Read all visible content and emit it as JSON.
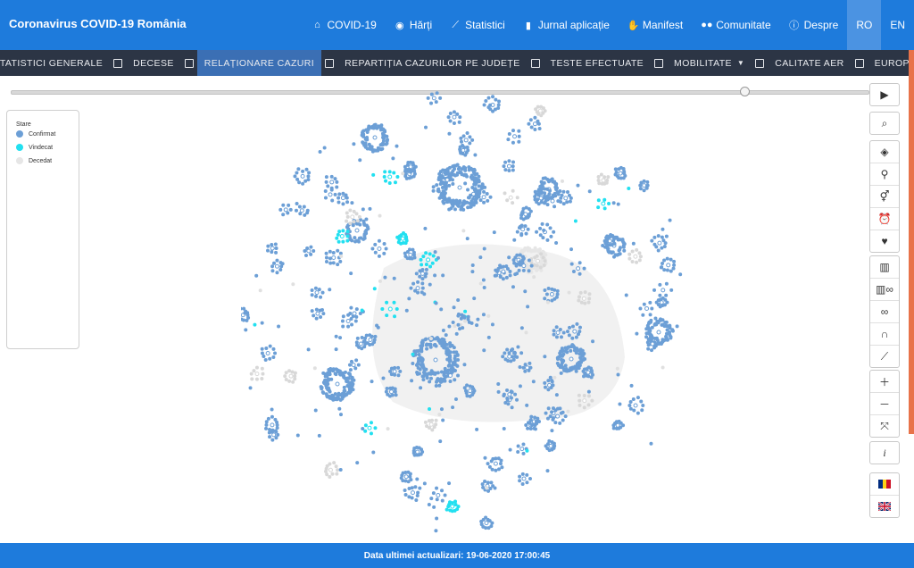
{
  "app": {
    "title": "Coronavirus COVID-19 România"
  },
  "nav": {
    "items": [
      {
        "label": "COVID-19",
        "icon": "home-icon"
      },
      {
        "label": "Hărți",
        "icon": "compass-icon"
      },
      {
        "label": "Statistici",
        "icon": "chart-icon"
      },
      {
        "label": "Jurnal aplicație",
        "icon": "file-icon"
      },
      {
        "label": "Manifest",
        "icon": "hand-icon"
      },
      {
        "label": "Comunitate",
        "icon": "users-icon"
      },
      {
        "label": "Despre",
        "icon": "info-icon"
      }
    ],
    "lang_ro": "RO",
    "lang_en": "EN"
  },
  "subnav": {
    "items": [
      "STATISTICI GENERALE",
      "DECESE",
      "RELAȚIONARE CAZURI",
      "REPARTIȚIA CAZURILOR PE JUDEȚE",
      "TESTE EFECTUATE",
      "MOBILITATE",
      "CALITATE AER",
      "EUROPA"
    ],
    "active": "RELAȚIONARE CAZURI"
  },
  "legend": {
    "title": "Stare",
    "items": [
      {
        "label": "Confirmat",
        "color": "#6c9fd6"
      },
      {
        "label": "Vindecat",
        "color": "#22e0f0"
      },
      {
        "label": "Decedat",
        "color": "#e6e6e6"
      }
    ]
  },
  "timeline": {
    "position_fraction": 0.85
  },
  "footer": {
    "text": "Data ultimei actualizari: 19-06-2020 17:00:45"
  },
  "colors": {
    "brand": "#1e7bdc",
    "subnav": "#2c3545",
    "confirmed": "#6c9fd6",
    "recovered": "#22e0f0",
    "deceased": "#e6e6e6"
  },
  "toolbar": {
    "groups": [
      [
        "play-icon"
      ],
      [
        "search-icon"
      ],
      [
        "layers-icon",
        "pin-icon",
        "gender-icon",
        "alarm-icon",
        "heart-icon"
      ],
      [
        "map-icon",
        "map-link-icon",
        "link-icon",
        "arc-icon",
        "trend-icon"
      ],
      [
        "plus-icon",
        "minus-icon",
        "fit-icon"
      ],
      [
        "info-icon"
      ],
      [
        "flag-ro-icon",
        "flag-gb-icon"
      ]
    ]
  }
}
